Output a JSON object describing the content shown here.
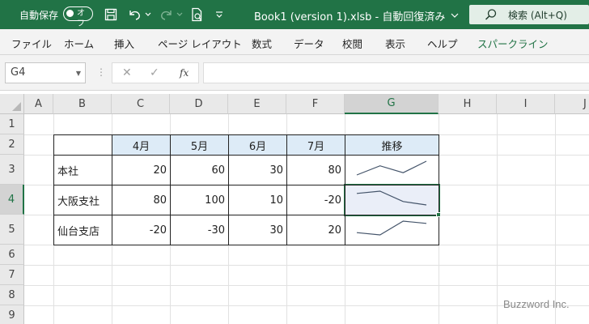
{
  "titlebar": {
    "autosave_label": "自動保存",
    "autosave_toggle": "オフ",
    "title": "Book1 (version 1).xlsb  -  自動回復済み",
    "search_placeholder": "検索 (Alt+Q)"
  },
  "ribbon": {
    "tabs": [
      "ファイル",
      "ホーム",
      "挿入",
      "ページ レイアウト",
      "数式",
      "データ",
      "校閲",
      "表示",
      "ヘルプ",
      "スパークライン"
    ],
    "active_tab": "スパークライン"
  },
  "formula_bar": {
    "name_box": "G4",
    "formula": "",
    "fx_label": "fx"
  },
  "sheet": {
    "columns": [
      "A",
      "B",
      "C",
      "D",
      "E",
      "F",
      "G",
      "H",
      "I",
      "J"
    ],
    "rows": [
      "1",
      "2",
      "3",
      "4",
      "5",
      "6",
      "7",
      "8",
      "9"
    ],
    "selected_cell": "G4",
    "table": {
      "headers": [
        "4月",
        "5月",
        "6月",
        "7月",
        "推移"
      ],
      "rows": [
        {
          "label": "本社",
          "values": [
            "20",
            "60",
            "30",
            "80"
          ]
        },
        {
          "label": "大阪支社",
          "values": [
            "80",
            "100",
            "10",
            "-20"
          ]
        },
        {
          "label": "仙台支店",
          "values": [
            "-20",
            "-30",
            "30",
            "20"
          ]
        }
      ]
    },
    "sparklines": [
      {
        "row": "本社",
        "values": [
          20,
          60,
          30,
          80
        ]
      },
      {
        "row": "大阪支社",
        "values": [
          80,
          100,
          10,
          -20
        ]
      },
      {
        "row": "仙台支店",
        "values": [
          -20,
          -30,
          30,
          20
        ]
      }
    ]
  },
  "colors": {
    "accent": "#217346",
    "header_fill": "#ddebf7",
    "sparkline": "#44546a"
  },
  "watermark": "Buzzword Inc."
}
